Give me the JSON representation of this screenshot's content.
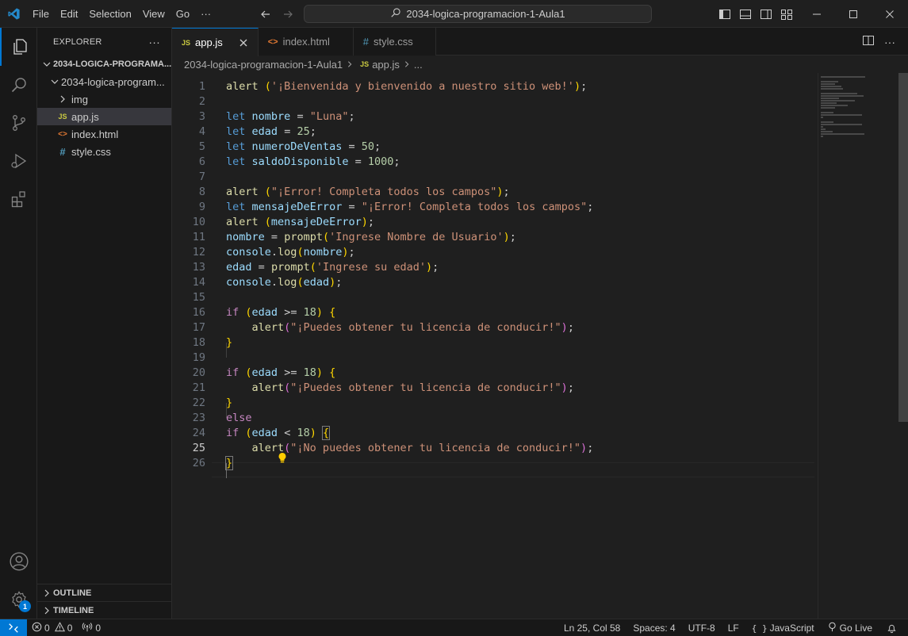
{
  "titlebar": {
    "menu": [
      "File",
      "Edit",
      "Selection",
      "View",
      "Go",
      "···"
    ],
    "search_text": "2034-logica-programacion-1-Aula1"
  },
  "activitybar": {
    "items": [
      "explorer",
      "search",
      "source-control",
      "run-debug",
      "extensions"
    ],
    "settings_badge": "1"
  },
  "sidebar": {
    "title": "EXPLORER",
    "more": "···",
    "root": "2034-LOGICA-PROGRAMA...",
    "folder": "2034-logica-program...",
    "items": [
      {
        "label": "img",
        "type": "folder"
      },
      {
        "label": "app.js",
        "type": "js",
        "badge": "JS"
      },
      {
        "label": "index.html",
        "type": "html",
        "badge": "<>"
      },
      {
        "label": "style.css",
        "type": "css",
        "badge": "#"
      }
    ],
    "outline": "OUTLINE",
    "timeline": "TIMELINE"
  },
  "editor": {
    "tabs": [
      {
        "label": "app.js",
        "icon": "JS",
        "active": true
      },
      {
        "label": "index.html",
        "icon": "<>",
        "active": false
      },
      {
        "label": "style.css",
        "icon": "#",
        "active": false
      }
    ],
    "breadcrumb": {
      "folder": "2034-logica-programacion-1-Aula1",
      "file_icon": "JS",
      "file": "app.js",
      "tail": "..."
    },
    "current_line": 25,
    "line_numbers": [
      "1",
      "2",
      "3",
      "4",
      "5",
      "6",
      "7",
      "8",
      "9",
      "10",
      "11",
      "12",
      "13",
      "14",
      "15",
      "16",
      "17",
      "18",
      "19",
      "20",
      "21",
      "22",
      "23",
      "24",
      "25",
      "26"
    ]
  },
  "code": {
    "l1_fn": "alert",
    "l1_str": "'¡Bienvenida y bienvenido a nuestro sitio web!'",
    "l3_var": "nombre",
    "l3_val": "\"Luna\"",
    "l4_var": "edad",
    "l4_val": "25",
    "l5_var": "numeroDeVentas",
    "l5_val": "50",
    "l6_var": "saldoDisponible",
    "l6_val": "1000",
    "l8_str": "\"¡Error! Completa todos los campos\"",
    "l9_var": "mensajeDeError",
    "l9_str": "\"¡Error! Completa todos los campos\"",
    "l12_obj": "console",
    "l12_fn": "log",
    "l11_str": "'Ingrese Nombre de Usuario'",
    "l13_str": "'Ingrese su edad'",
    "l17_str": "\"¡Puedes obtener tu licencia de conducir!\"",
    "l25_str": "\"¡No puedes obtener tu licencia de conducir!\"",
    "kw_let": "let",
    "kw_if": "if",
    "kw_else": "else",
    "fn_prompt": "prompt",
    "n18": "18"
  },
  "statusbar": {
    "errors": "0",
    "warnings": "0",
    "ports": "0",
    "position": "Ln 25, Col 58",
    "spaces": "Spaces: 4",
    "encoding": "UTF-8",
    "eol": "LF",
    "language": "JavaScript",
    "golive": "Go Live"
  },
  "colors": {
    "accent": "#0078d4",
    "background": "#1f1f1f",
    "sidebar": "#181818"
  }
}
